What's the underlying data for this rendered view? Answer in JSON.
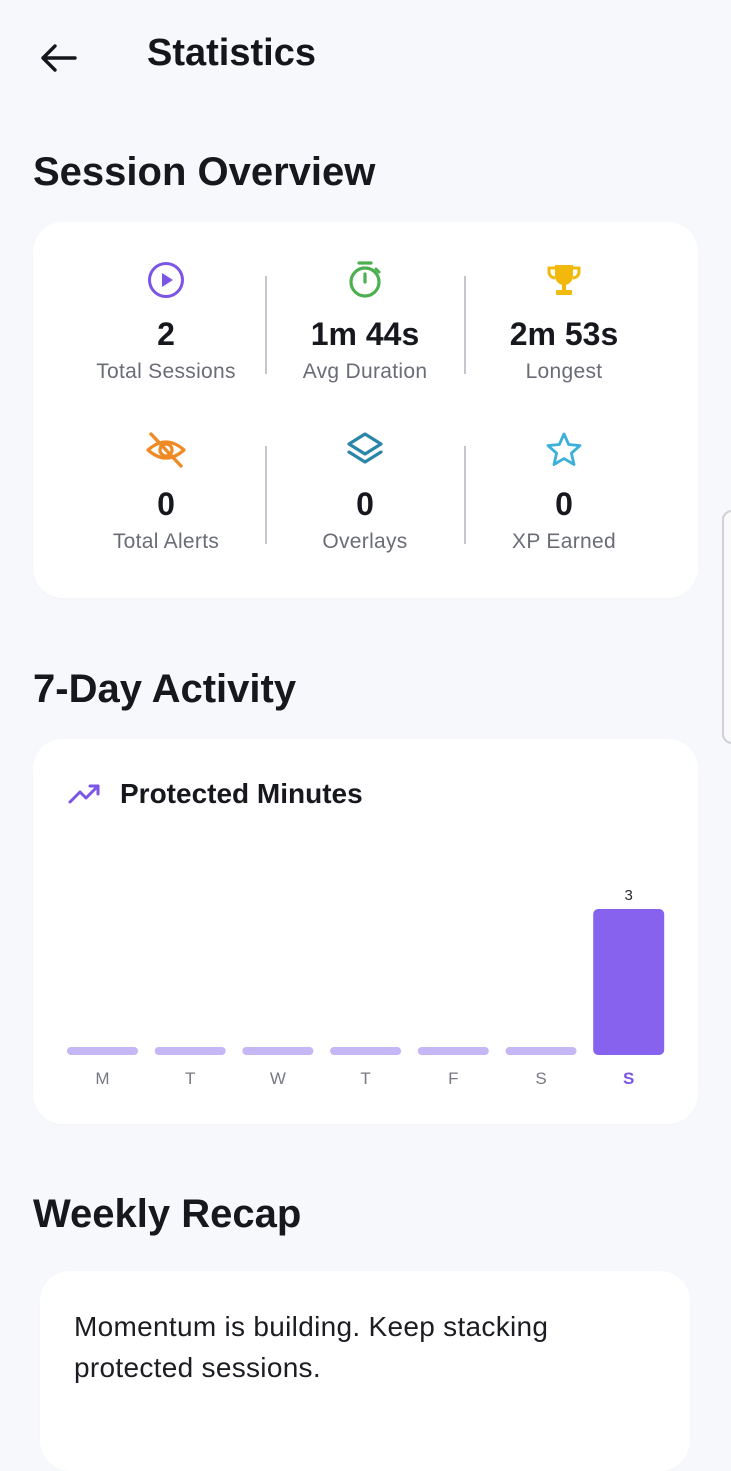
{
  "header": {
    "title": "Statistics"
  },
  "session_overview": {
    "title": "Session Overview",
    "stats": [
      {
        "icon": "play-circle-icon",
        "value": "2",
        "label": "Total Sessions",
        "color": "#7b55e6"
      },
      {
        "icon": "stopwatch-icon",
        "value": "1m 44s",
        "label": "Avg Duration",
        "color": "#4caf50"
      },
      {
        "icon": "trophy-icon",
        "value": "2m 53s",
        "label": "Longest",
        "color": "#f2b90c"
      },
      {
        "icon": "eye-off-icon",
        "value": "0",
        "label": "Total Alerts",
        "color": "#f08a24"
      },
      {
        "icon": "layers-icon",
        "value": "0",
        "label": "Overlays",
        "color": "#2a86a8"
      },
      {
        "icon": "star-icon",
        "value": "0",
        "label": "XP Earned",
        "color": "#3bb0d8"
      }
    ]
  },
  "activity": {
    "title": "7-Day Activity",
    "chart_title": "Protected Minutes"
  },
  "chart_data": {
    "type": "bar",
    "title": "Protected Minutes",
    "categories": [
      "M",
      "T",
      "W",
      "T",
      "F",
      "S",
      "S"
    ],
    "values": [
      0,
      0,
      0,
      0,
      0,
      0,
      3
    ],
    "data_labels": [
      "",
      "",
      "",
      "",
      "",
      "",
      "3"
    ],
    "highlight_index": 6,
    "colors": {
      "bar": "#c5b6f5",
      "highlight": "#8762ee",
      "label_highlight": "#7b55e6",
      "label": "#777983"
    }
  },
  "weekly_recap": {
    "title": "Weekly Recap",
    "text": "Momentum is building. Keep stacking protected sessions."
  }
}
